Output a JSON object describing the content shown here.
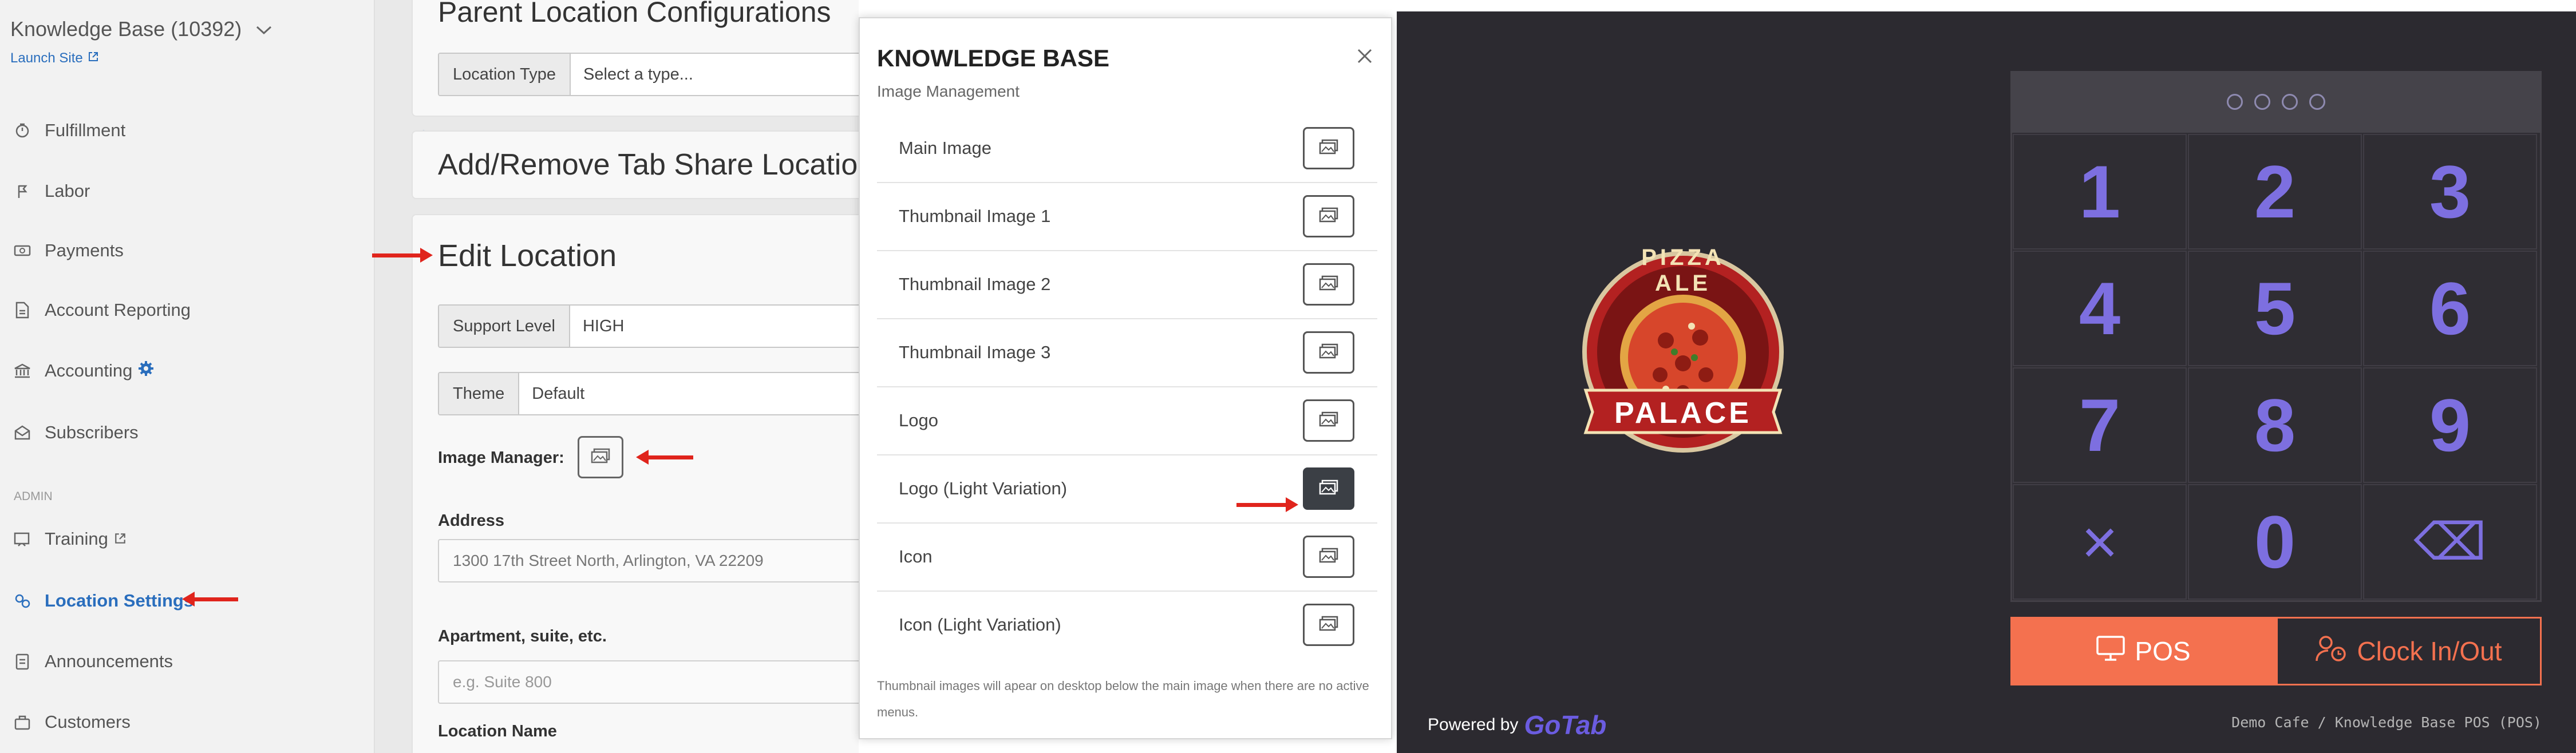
{
  "sidebar": {
    "site_title": "Knowledge Base (10392)",
    "launch_site": "Launch Site",
    "admin_section": "ADMIN",
    "items": [
      {
        "label": "Fulfillment",
        "icon": "timer-icon"
      },
      {
        "label": "Labor",
        "icon": "labor-icon"
      },
      {
        "label": "Payments",
        "icon": "payments-icon"
      },
      {
        "label": "Account Reporting",
        "icon": "report-icon"
      },
      {
        "label": "Accounting",
        "icon": "bank-icon"
      },
      {
        "label": "Subscribers",
        "icon": "mail-icon"
      },
      {
        "label": "Training",
        "icon": "training-icon"
      },
      {
        "label": "Location Settings",
        "icon": "location-settings-icon"
      },
      {
        "label": "Announcements",
        "icon": "announcement-icon"
      },
      {
        "label": "Customers",
        "icon": "customers-icon"
      }
    ]
  },
  "main": {
    "parent_heading": "Parent Location Configurations",
    "location_type_label": "Location Type",
    "location_type_placeholder": "Select a type...",
    "tab_share_heading": "Add/Remove Tab Share Location",
    "edit_heading": "Edit Location",
    "support_level_label": "Support Level",
    "support_level_value": "HIGH",
    "theme_label": "Theme",
    "theme_value": "Default",
    "image_manager_label": "Image Manager:",
    "address_label": "Address",
    "address_value": "1300 17th Street North, Arlington, VA 22209",
    "apartment_label": "Apartment, suite, etc.",
    "apartment_placeholder": "e.g. Suite 800",
    "location_name_label": "Location Name"
  },
  "modal": {
    "title": "KNOWLEDGE BASE",
    "subtitle": "Image Management",
    "rows": [
      "Main Image",
      "Thumbnail Image 1",
      "Thumbnail Image 2",
      "Thumbnail Image 3",
      "Logo",
      "Logo (Light Variation)",
      "Icon",
      "Icon (Light Variation)"
    ],
    "note": "Thumbnail images will apear on desktop below the main image when there are no active menus."
  },
  "pos": {
    "logo_top_text": "PIZZA ALE",
    "logo_banner_text": "PALACE",
    "keys": [
      "1",
      "2",
      "3",
      "4",
      "5",
      "6",
      "7",
      "8",
      "9",
      "×",
      "0",
      "⌫"
    ],
    "pos_button": "POS",
    "clock_button": "Clock In/Out",
    "powered_by": "Powered by",
    "brand": "GoTab",
    "footer": "Demo Cafe / Knowledge Base POS (POS)",
    "accent_color": "#f4714f",
    "key_color": "#7d6fe0"
  }
}
